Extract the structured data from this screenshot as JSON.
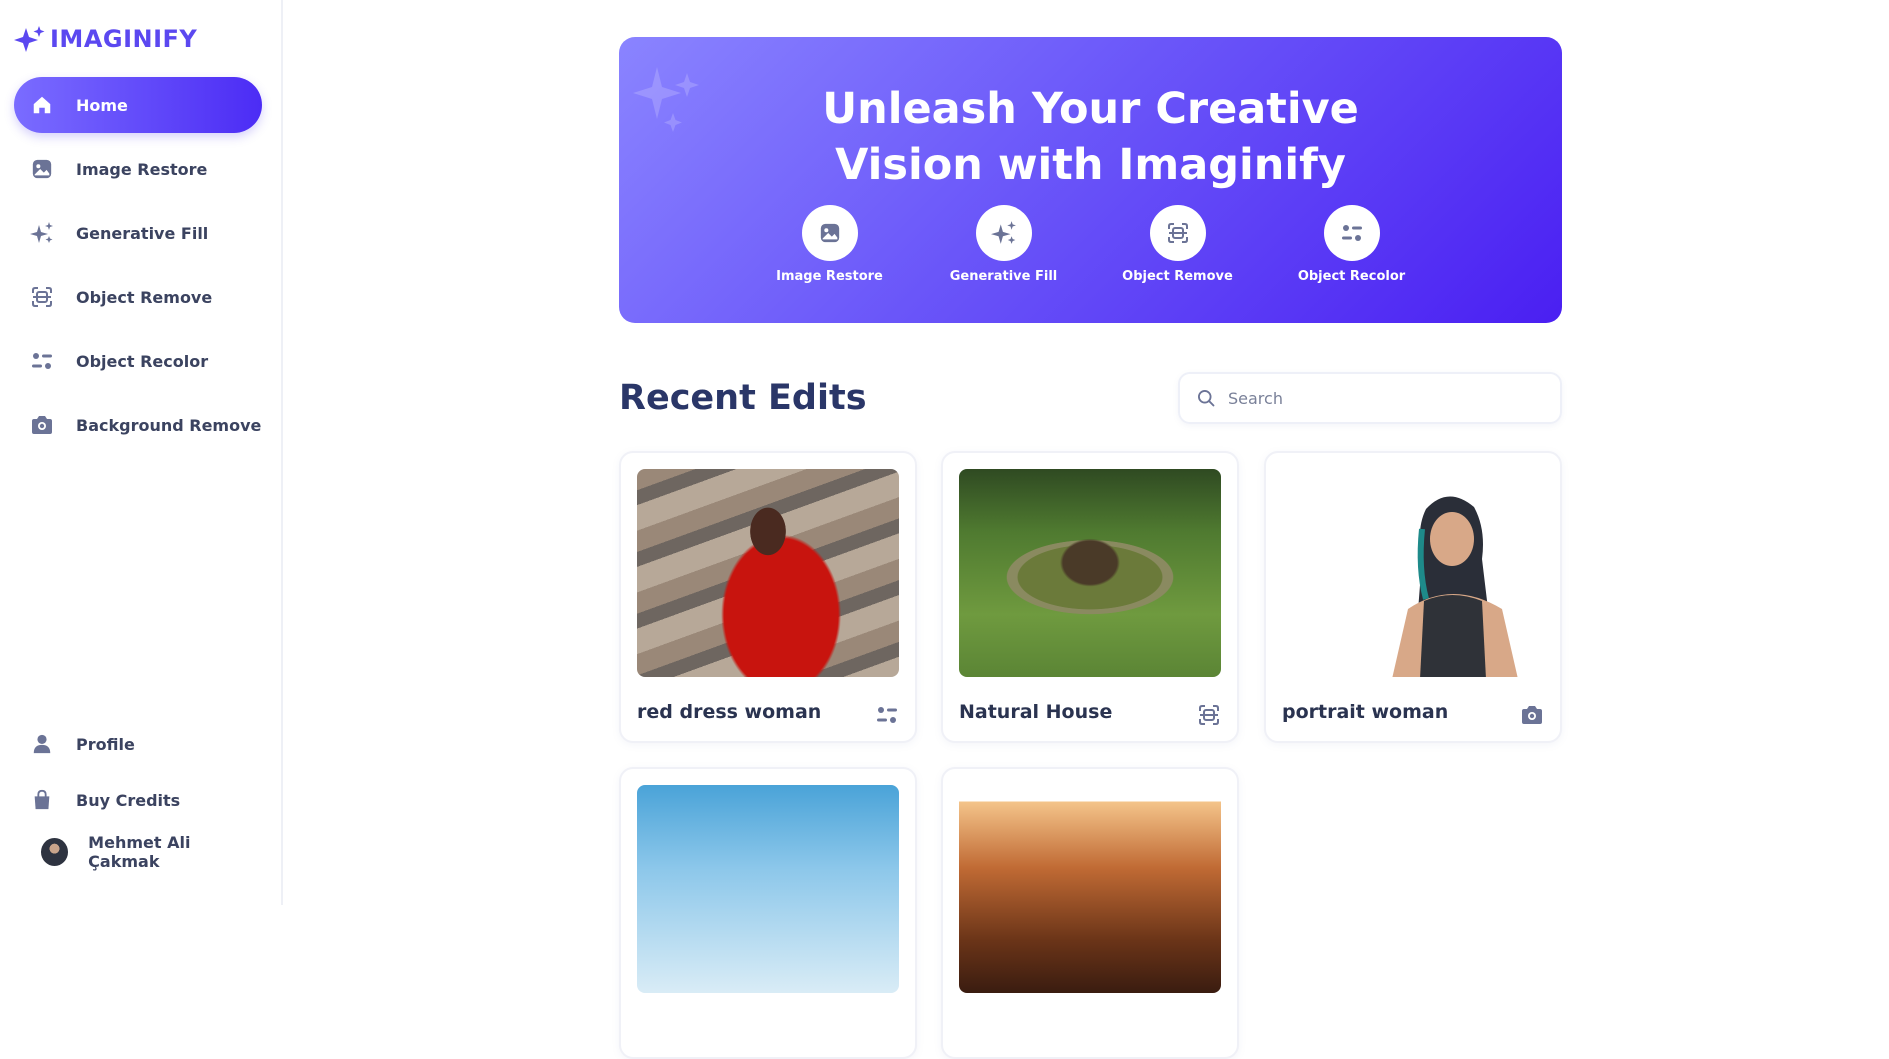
{
  "app": {
    "name": "IMAGINIFY"
  },
  "sidebar": {
    "items": [
      {
        "label": "Home",
        "icon": "home-icon",
        "active": true
      },
      {
        "label": "Image Restore",
        "icon": "image-icon"
      },
      {
        "label": "Generative Fill",
        "icon": "sparkles-icon"
      },
      {
        "label": "Object Remove",
        "icon": "scan-icon"
      },
      {
        "label": "Object Recolor",
        "icon": "filter-icon"
      },
      {
        "label": "Background Remove",
        "icon": "camera-icon"
      }
    ],
    "bottom": [
      {
        "label": "Profile",
        "icon": "user-icon"
      },
      {
        "label": "Buy Credits",
        "icon": "bag-icon"
      }
    ],
    "user": {
      "name": "Mehmet Ali Çakmak"
    }
  },
  "hero": {
    "title_line1": "Unleash Your Creative",
    "title_line2": "Vision with Imaginify",
    "tools": [
      {
        "label": "Image Restore",
        "icon": "image-icon"
      },
      {
        "label": "Generative Fill",
        "icon": "sparkles-icon"
      },
      {
        "label": "Object Remove",
        "icon": "scan-icon"
      },
      {
        "label": "Object Recolor",
        "icon": "filter-icon"
      }
    ]
  },
  "recent": {
    "title": "Recent Edits",
    "search_placeholder": "Search",
    "items": [
      {
        "title": "red dress woman",
        "icon": "filter-icon"
      },
      {
        "title": "Natural House",
        "icon": "scan-icon"
      },
      {
        "title": "portrait woman",
        "icon": "camera-icon"
      },
      {
        "title": "",
        "icon": ""
      },
      {
        "title": "",
        "icon": ""
      }
    ]
  },
  "colors": {
    "accent": "#5b48f0",
    "heroStart": "#8a84ff",
    "heroEnd": "#4a1ff2",
    "iconGray": "#6b7396"
  }
}
